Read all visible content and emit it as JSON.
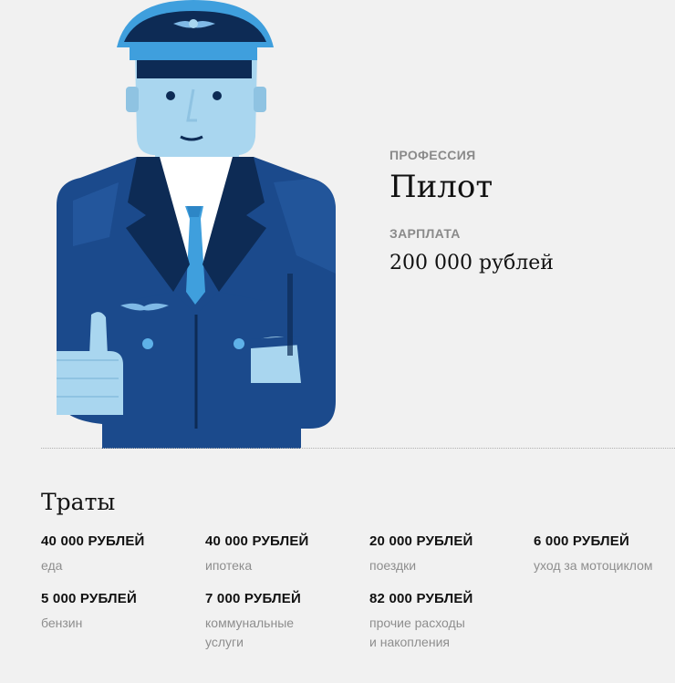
{
  "profile": {
    "profession_label": "ПРОФЕССИЯ",
    "profession": "Пилот",
    "salary_label": "ЗАРПЛАТА",
    "salary": "200 000 рублей"
  },
  "expenses": {
    "title": "Траты",
    "items": [
      {
        "amount": "40 000 РУБЛЕЙ",
        "desc": "еда"
      },
      {
        "amount": "40 000 РУБЛЕЙ",
        "desc": "ипотека"
      },
      {
        "amount": "20 000 РУБЛЕЙ",
        "desc": "поездки"
      },
      {
        "amount": "6 000 РУБЛЕЙ",
        "desc": "уход за мотоциклом"
      },
      {
        "amount": "5 000 РУБЛЕЙ",
        "desc": "бензин"
      },
      {
        "amount": "7 000 РУБЛЕЙ",
        "desc": "коммунальные\nуслуги"
      },
      {
        "amount": "82 000 РУБЛЕЙ",
        "desc": "прочие расходы\nи накопления"
      }
    ]
  },
  "colors": {
    "background": "#f1f1f1",
    "jacket": "#1b4a8c",
    "jacket_dark": "#0d2b55",
    "skin": "#a9d6ef",
    "accent": "#3f9fdd"
  },
  "icons": [
    "pilot-illustration",
    "wings-emblem-icon"
  ]
}
